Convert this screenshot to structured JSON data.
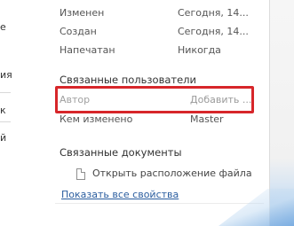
{
  "left_panel": {
    "fragments": [
      "е",
      "ия",
      "к",
      "й"
    ]
  },
  "properties": {
    "rows": [
      {
        "label": "Изменен",
        "value": "Сегодня, 14..."
      },
      {
        "label": "Создан",
        "value": "Сегодня, 14..."
      },
      {
        "label": "Напечатан",
        "value": "Никогда"
      }
    ]
  },
  "related_people": {
    "title": "Связанные пользователи",
    "author_label": "Автор",
    "author_placeholder": "Добавить ...",
    "modified_by_label": "Кем изменено",
    "modified_by_value": "Master"
  },
  "related_documents": {
    "title": "Связанные документы",
    "open_location_label": "Открыть расположение файла",
    "show_all_props_label": "Показать все свойства"
  },
  "colors": {
    "highlight": "#d7262a",
    "link": "#2a5d9f"
  }
}
